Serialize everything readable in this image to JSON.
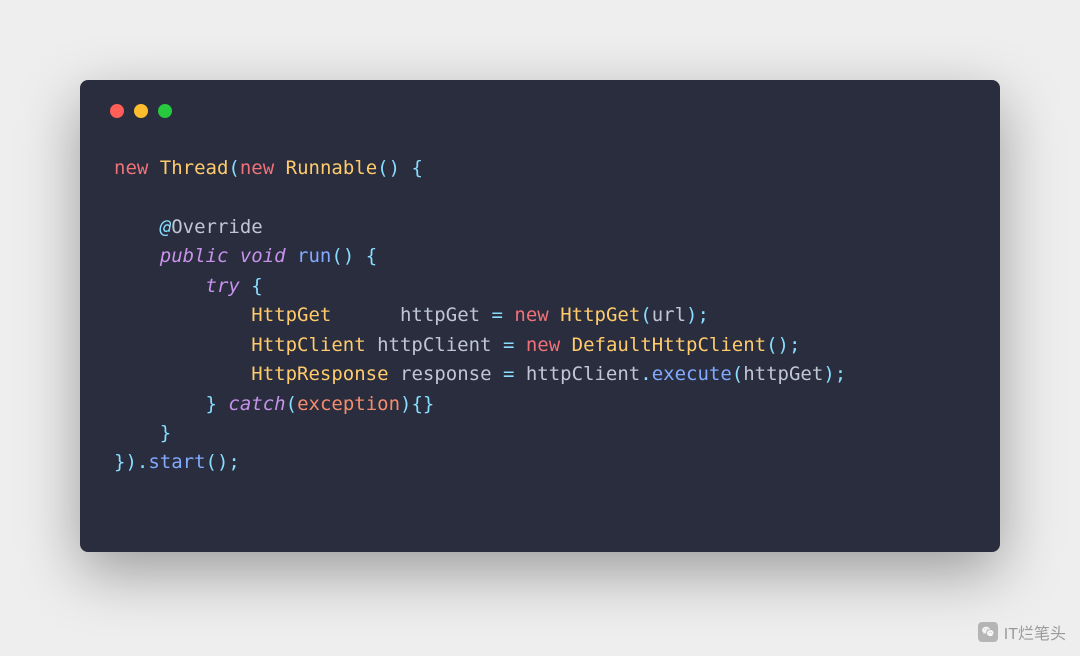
{
  "code": {
    "tokens": [
      [
        {
          "t": "new ",
          "c": "kw-new"
        },
        {
          "t": "Thread",
          "c": "type"
        },
        {
          "t": "(",
          "c": "punct"
        },
        {
          "t": "new ",
          "c": "kw-new"
        },
        {
          "t": "Runnable",
          "c": "type"
        },
        {
          "t": "() {",
          "c": "punct"
        }
      ],
      [],
      [
        {
          "t": "    ",
          "c": "plain"
        },
        {
          "t": "@",
          "c": "at"
        },
        {
          "t": "Override",
          "c": "anno"
        }
      ],
      [
        {
          "t": "    ",
          "c": "plain"
        },
        {
          "t": "public ",
          "c": "kw-mod"
        },
        {
          "t": "void ",
          "c": "kw-mod"
        },
        {
          "t": "run",
          "c": "fn"
        },
        {
          "t": "() {",
          "c": "punct"
        }
      ],
      [
        {
          "t": "        ",
          "c": "plain"
        },
        {
          "t": "try ",
          "c": "kw-flow"
        },
        {
          "t": "{",
          "c": "punct"
        }
      ],
      [
        {
          "t": "            ",
          "c": "plain"
        },
        {
          "t": "HttpGet",
          "c": "type"
        },
        {
          "t": "      httpGet ",
          "c": "plain"
        },
        {
          "t": "=",
          "c": "punct"
        },
        {
          "t": " ",
          "c": "plain"
        },
        {
          "t": "new ",
          "c": "kw-new"
        },
        {
          "t": "HttpGet",
          "c": "type"
        },
        {
          "t": "(",
          "c": "punct"
        },
        {
          "t": "url",
          "c": "plain"
        },
        {
          "t": ");",
          "c": "punct"
        }
      ],
      [
        {
          "t": "            ",
          "c": "plain"
        },
        {
          "t": "HttpClient",
          "c": "type"
        },
        {
          "t": " httpClient ",
          "c": "plain"
        },
        {
          "t": "=",
          "c": "punct"
        },
        {
          "t": " ",
          "c": "plain"
        },
        {
          "t": "new ",
          "c": "kw-new"
        },
        {
          "t": "DefaultHttpClient",
          "c": "type"
        },
        {
          "t": "();",
          "c": "punct"
        }
      ],
      [
        {
          "t": "            ",
          "c": "plain"
        },
        {
          "t": "HttpResponse",
          "c": "type"
        },
        {
          "t": " response ",
          "c": "plain"
        },
        {
          "t": "=",
          "c": "punct"
        },
        {
          "t": " httpClient",
          "c": "plain"
        },
        {
          "t": ".",
          "c": "punct"
        },
        {
          "t": "execute",
          "c": "fn"
        },
        {
          "t": "(",
          "c": "punct"
        },
        {
          "t": "httpGet",
          "c": "plain"
        },
        {
          "t": ");",
          "c": "punct"
        }
      ],
      [
        {
          "t": "        ",
          "c": "plain"
        },
        {
          "t": "} ",
          "c": "punct"
        },
        {
          "t": "catch",
          "c": "kw-flow"
        },
        {
          "t": "(",
          "c": "punct"
        },
        {
          "t": "exception",
          "c": "param"
        },
        {
          "t": "){}",
          "c": "punct"
        }
      ],
      [
        {
          "t": "    ",
          "c": "plain"
        },
        {
          "t": "}",
          "c": "punct"
        }
      ],
      [
        {
          "t": "}).",
          "c": "punct"
        },
        {
          "t": "start",
          "c": "fn"
        },
        {
          "t": "();",
          "c": "punct"
        }
      ]
    ]
  },
  "watermark": {
    "text": "IT烂笔头"
  }
}
